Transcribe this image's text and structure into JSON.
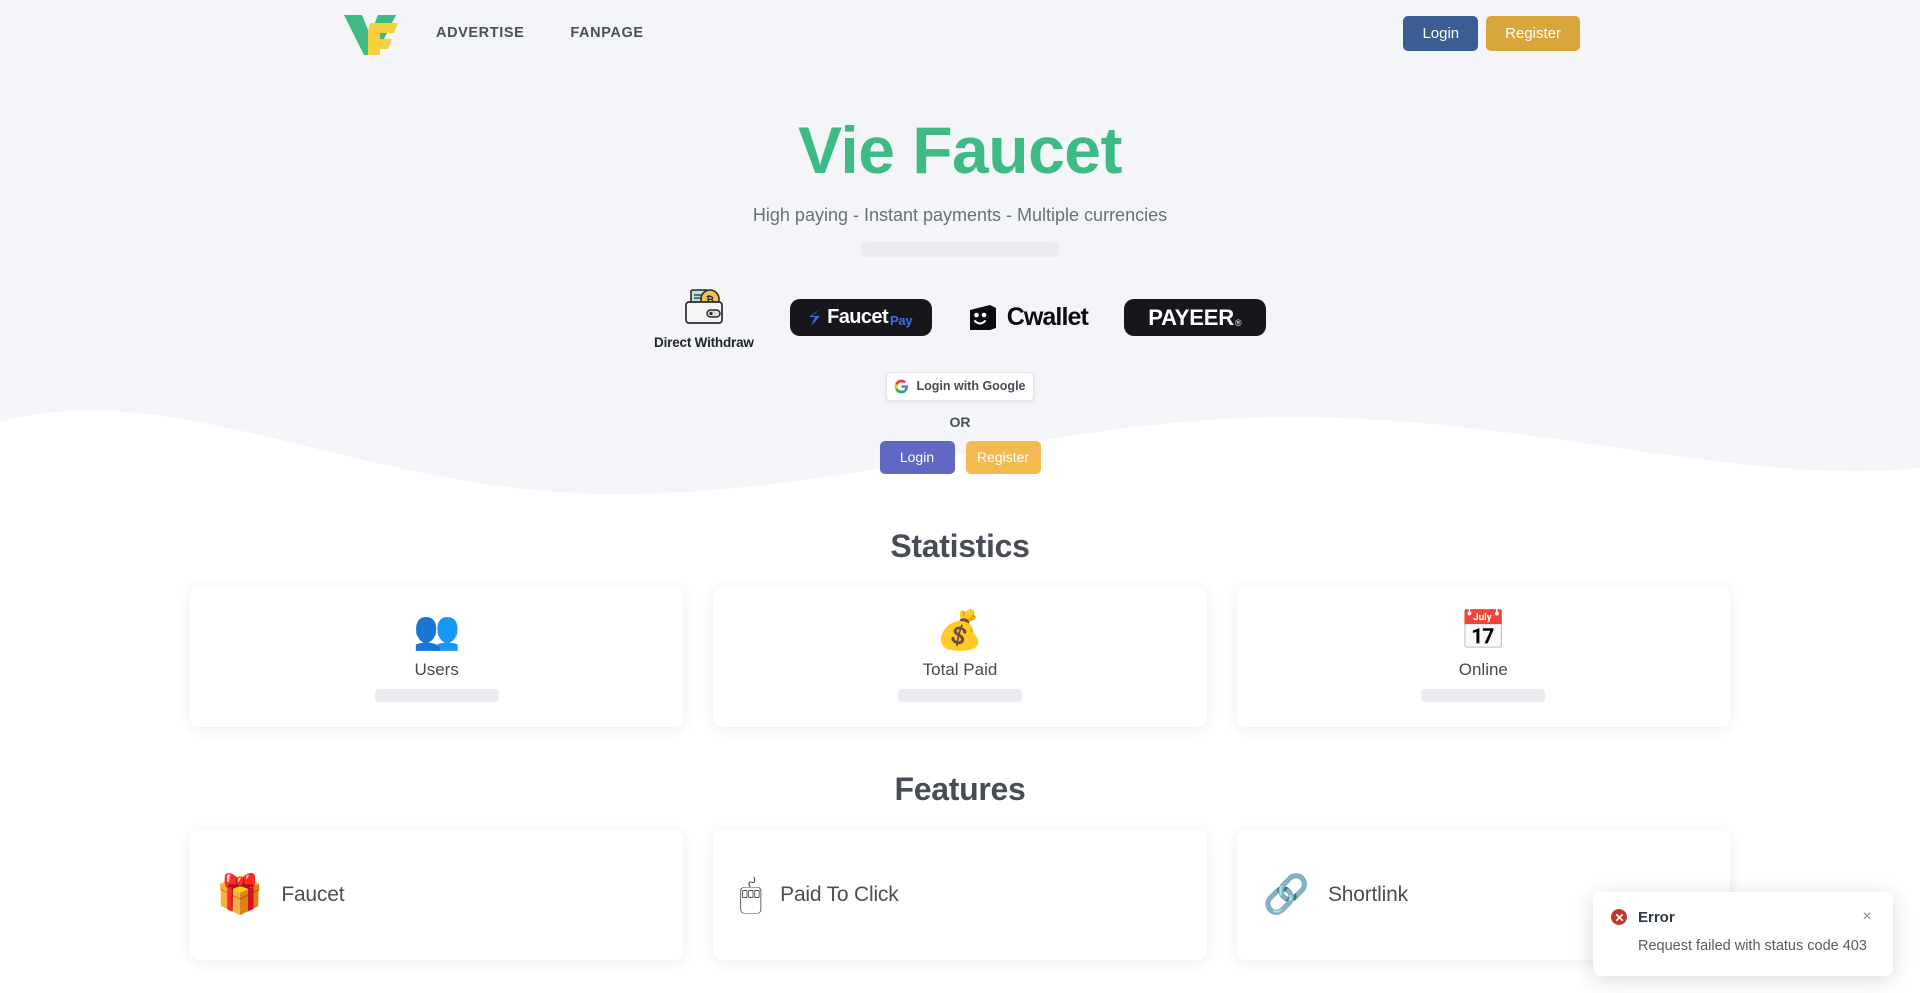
{
  "nav": {
    "logo_alt": "Vie Faucet logo",
    "links": [
      {
        "label": "ADVERTISE"
      },
      {
        "label": "FANPAGE"
      }
    ],
    "login_label": "Login",
    "register_label": "Register"
  },
  "hero": {
    "title": "Vie Faucet",
    "subtitle": "High paying - Instant payments - Multiple currencies",
    "payments": [
      {
        "name": "Direct Withdraw",
        "label": "Direct Withdraw"
      },
      {
        "name": "FaucetPay",
        "text_main": "Faucet",
        "text_accent": "Pay"
      },
      {
        "name": "Cwallet",
        "text_main": "Cwallet"
      },
      {
        "name": "Payeer",
        "text_main": "PAYEER",
        "text_accent": "®"
      }
    ],
    "google_label": "Login with Google",
    "or_label": "OR",
    "login_label": "Login",
    "register_label": "Register"
  },
  "statistics": {
    "title": "Statistics",
    "cards": [
      {
        "label": "Users",
        "emoji": "👥",
        "value": ""
      },
      {
        "label": "Total Paid",
        "emoji": "💰",
        "value": ""
      },
      {
        "label": "Online",
        "emoji": "📅",
        "value": ""
      }
    ]
  },
  "features": {
    "title": "Features",
    "cards": [
      {
        "label": "Faucet",
        "emoji": "🎁"
      },
      {
        "label": "Paid To Click",
        "emoji": "🖱"
      },
      {
        "label": "Shortlink",
        "emoji": "🔗"
      }
    ]
  },
  "toast": {
    "title": "Error",
    "message": "Request failed with status code 403",
    "close_label": "×",
    "accent_color": "#c0392b"
  },
  "colors": {
    "brand_green": "#3eba85",
    "brand_yellow": "#f6d13c",
    "hero_bg": "#f4f5f9",
    "nav_login": "#3c5c94",
    "nav_register": "#d9a63c",
    "hero_login": "#6068c4",
    "hero_register": "#f3ba4f"
  }
}
